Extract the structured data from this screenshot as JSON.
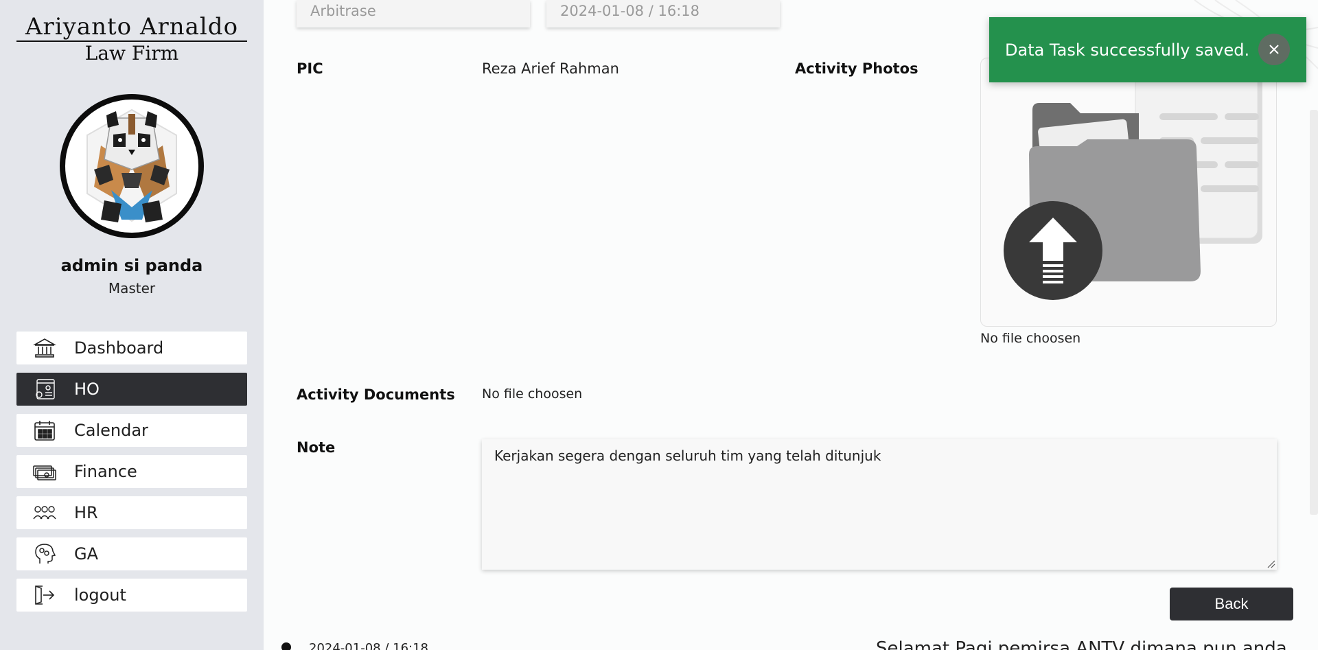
{
  "brand": {
    "line1": "Ariyanto Arnaldo",
    "line2": "Law Firm"
  },
  "user": {
    "name": "admin si panda",
    "role": "Master"
  },
  "nav": [
    {
      "label": "Dashboard",
      "icon": "bank-icon",
      "active": false
    },
    {
      "label": "HO",
      "icon": "settings-document-icon",
      "active": true
    },
    {
      "label": "Calendar",
      "icon": "calendar-icon",
      "active": false
    },
    {
      "label": "Finance",
      "icon": "money-icon",
      "active": false
    },
    {
      "label": "HR",
      "icon": "people-icon",
      "active": false
    },
    {
      "label": "GA",
      "icon": "head-gears-icon",
      "active": false
    },
    {
      "label": "logout",
      "icon": "logout-icon",
      "active": false
    }
  ],
  "form": {
    "category_value": "Arbitrase",
    "datetime_value": "2024-01-08 / 16:18",
    "pic_label": "PIC",
    "pic_value": "Reza Arief Rahman",
    "photos_label": "Activity Photos",
    "photos_status": "No file choosen",
    "documents_label": "Activity Documents",
    "documents_status": "No file choosen",
    "note_label": "Note",
    "note_value": "Kerjakan segera dengan seluruh tim yang telah ditunjuk"
  },
  "buttons": {
    "back": "Back"
  },
  "timeline": {
    "date": "2024-01-08 / 16:18",
    "text": "Selamat Pagi pemirsa ANTV dimana pun anda"
  },
  "toast": {
    "message": "Data Task successfully saved.",
    "color": "#24914d"
  },
  "colors": {
    "accent_dark": "#2e2f33",
    "sidebar_bg": "#e4e6eb",
    "success": "#24914d"
  }
}
